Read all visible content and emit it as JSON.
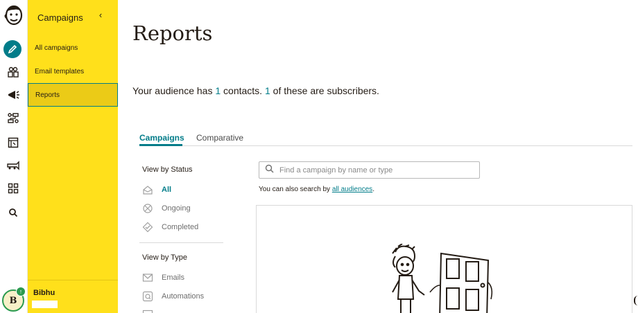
{
  "rail": {
    "icons": [
      "freddie-logo-icon",
      "pencil-icon",
      "audience-icon",
      "megaphone-icon",
      "automations-icon",
      "website-icon",
      "content-icon",
      "integrations-icon",
      "search-icon"
    ]
  },
  "sidebar": {
    "heading": "Campaigns",
    "collapse_glyph": "‹",
    "items": [
      {
        "label": "All campaigns"
      },
      {
        "label": "Email templates"
      },
      {
        "label": "Reports"
      }
    ],
    "user_name": "Bibhu"
  },
  "avatar": {
    "initial": "B",
    "badge": "↑"
  },
  "main": {
    "title": "Reports",
    "summary": {
      "prefix": "Your audience has ",
      "contacts": "1",
      "middle": " contacts. ",
      "subscribers": "1",
      "suffix": " of these are subscribers."
    },
    "tabs": [
      {
        "label": "Campaigns"
      },
      {
        "label": "Comparative"
      }
    ],
    "filters": {
      "status_heading": "View by Status",
      "status": [
        {
          "label": "All"
        },
        {
          "label": "Ongoing"
        },
        {
          "label": "Completed"
        }
      ],
      "type_heading": "View by Type",
      "type": [
        {
          "label": "Emails"
        },
        {
          "label": "Automations"
        }
      ]
    },
    "search": {
      "placeholder": "Find a campaign by name or type",
      "hint_prefix": "You can also search by ",
      "hint_link": "all audiences",
      "hint_suffix": "."
    }
  },
  "colors": {
    "accent": "#007c89",
    "sidebar_bg": "#ffe01b",
    "sidebar_active": "#ebcb17",
    "text": "#241c15"
  }
}
